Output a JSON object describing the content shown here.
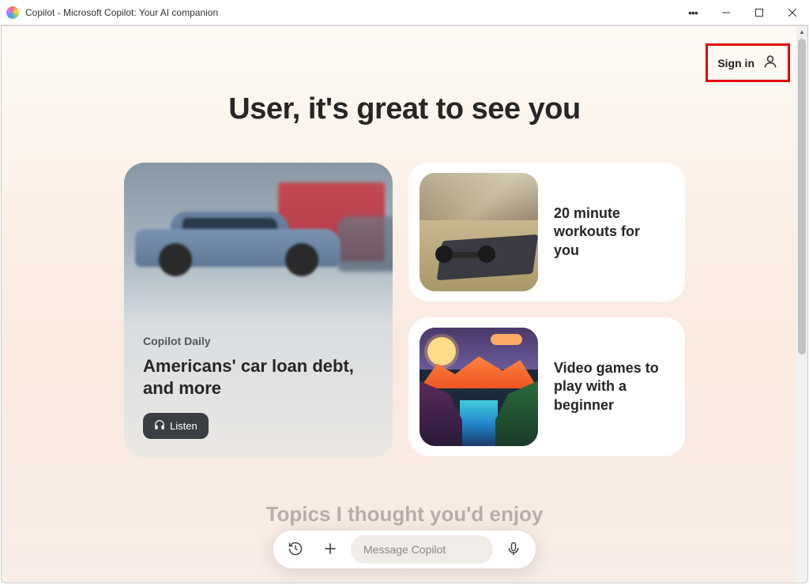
{
  "window": {
    "title": "Copilot - Microsoft Copilot: Your AI companion"
  },
  "header": {
    "signin_label": "Sign in"
  },
  "greeting": "User, it's great to see you",
  "daily": {
    "label": "Copilot Daily",
    "headline": "Americans' car loan debt, and more",
    "listen_label": "Listen"
  },
  "suggestions": [
    {
      "title": "20 minute workouts for you"
    },
    {
      "title": "Video games to play with a beginner"
    }
  ],
  "topics_heading": "Topics I thought you'd enjoy",
  "composer": {
    "placeholder": "Message Copilot"
  }
}
